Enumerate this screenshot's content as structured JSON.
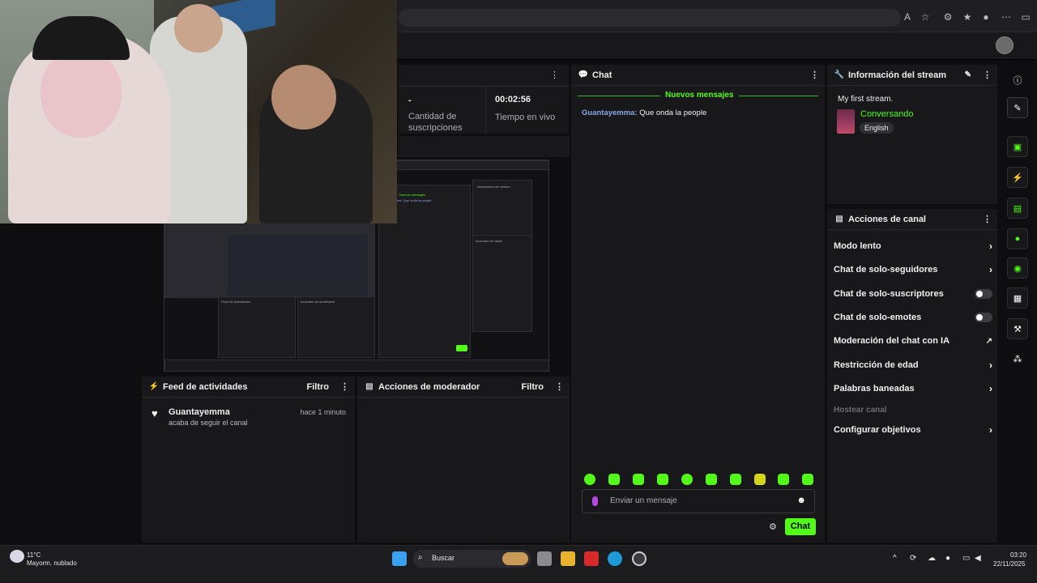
{
  "stats": {
    "subs_value": "-",
    "subs_label": "Cantidad de suscripciones",
    "time_value": "00:02:56",
    "time_label": "Tiempo en vivo"
  },
  "chat": {
    "title": "Chat",
    "new_messages": "Nuevos mensajes",
    "messages": [
      {
        "user": "Guantayemma",
        "text": "Que onda la people",
        "user_color": "#89a8e6"
      }
    ],
    "input_placeholder": "Enviar un mensaje",
    "send_label": "Chat"
  },
  "stream_info": {
    "title": "Información del stream",
    "stream_title": "My first stream.",
    "category": "Conversando",
    "language": "English"
  },
  "channel_actions": {
    "title": "Acciones de canal",
    "items": [
      {
        "label": "Modo lento",
        "control": "chevron"
      },
      {
        "label": "Chat de solo-seguidores",
        "control": "chevron"
      },
      {
        "label": "Chat de solo-suscriptores",
        "control": "toggle"
      },
      {
        "label": "Chat de solo-emotes",
        "control": "toggle"
      },
      {
        "label": "Moderación del chat con IA",
        "control": "external"
      },
      {
        "label": "Restricción de edad",
        "control": "chevron"
      },
      {
        "label": "Palabras baneadas",
        "control": "chevron"
      },
      {
        "label": "Hostear canal",
        "control": "none"
      },
      {
        "label": "Configurar objetivos",
        "control": "chevron"
      }
    ]
  },
  "feed": {
    "title": "Feed de actividades",
    "filter": "Filtro",
    "events": [
      {
        "user": "Guantayemma",
        "action": "acaba de seguir el canal",
        "time": "hace 1 minuto"
      }
    ]
  },
  "mod_actions": {
    "title": "Acciones de moderador",
    "filter": "Filtro"
  },
  "taskbar": {
    "weather_temp": "11°C",
    "weather_desc": "Mayorm. nublado",
    "search_label": "Buscar",
    "time": "03:20",
    "date": "22/11/2025"
  },
  "colors": {
    "accent": "#53fc18",
    "panel": "#18181b",
    "background": "#0e0e10"
  },
  "icons": [
    "info-icon",
    "pencil-icon",
    "screenshot-icon",
    "lightning-icon",
    "document-icon",
    "chat-bubble-icon",
    "broadcast-icon",
    "layout-icon",
    "wrench-icon",
    "apps-icon"
  ]
}
